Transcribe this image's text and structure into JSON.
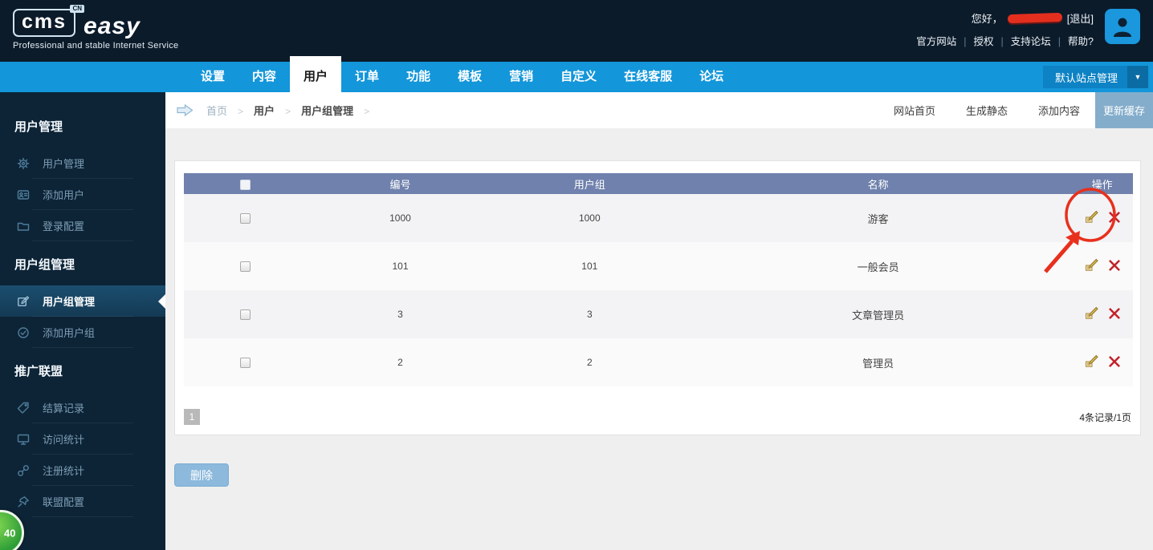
{
  "header": {
    "logo": {
      "cms": "cms",
      "cn": "CN",
      "easy": "easy",
      "tagline": "Professional and stable Internet Service"
    },
    "greeting_prefix": "您好，",
    "username_redacted": true,
    "logout_label": "[退出]",
    "links": [
      "官方网站",
      "授权",
      "支持论坛",
      "帮助?"
    ]
  },
  "nav": {
    "tabs": [
      {
        "label": "设置",
        "active": false
      },
      {
        "label": "内容",
        "active": false
      },
      {
        "label": "用户",
        "active": true
      },
      {
        "label": "订单",
        "active": false
      },
      {
        "label": "功能",
        "active": false
      },
      {
        "label": "模板",
        "active": false
      },
      {
        "label": "营销",
        "active": false
      },
      {
        "label": "自定义",
        "active": false
      },
      {
        "label": "在线客服",
        "active": false
      },
      {
        "label": "论坛",
        "active": false
      }
    ],
    "site_selector": "默认站点管理"
  },
  "sidebar": {
    "sections": [
      {
        "title": "用户管理",
        "items": [
          {
            "label": "用户管理",
            "icon": "gear-icon",
            "active": false
          },
          {
            "label": "添加用户",
            "icon": "id-card-icon",
            "active": false
          },
          {
            "label": "登录配置",
            "icon": "folder-icon",
            "active": false
          }
        ]
      },
      {
        "title": "用户组管理",
        "items": [
          {
            "label": "用户组管理",
            "icon": "edit-pad-icon",
            "active": true
          },
          {
            "label": "添加用户组",
            "icon": "check-circle-icon",
            "active": false
          }
        ]
      },
      {
        "title": "推广联盟",
        "items": [
          {
            "label": "结算记录",
            "icon": "tag-icon",
            "active": false
          },
          {
            "label": "访问统计",
            "icon": "monitor-icon",
            "active": false
          },
          {
            "label": "注册统计",
            "icon": "link-icon",
            "active": false
          },
          {
            "label": "联盟配置",
            "icon": "pin-icon",
            "active": false
          }
        ]
      }
    ],
    "badge": "40"
  },
  "breadcrumb": {
    "items": [
      "首页",
      "用户",
      "用户组管理"
    ]
  },
  "toolbar": {
    "quick_links": [
      "网站首页",
      "生成静态",
      "添加内容"
    ],
    "cache_button": "更新缓存"
  },
  "table": {
    "headers": [
      "编号",
      "用户组",
      "名称",
      "操作"
    ],
    "rows": [
      {
        "id": "1000",
        "group": "1000",
        "name": "游客"
      },
      {
        "id": "101",
        "group": "101",
        "name": "一般会员"
      },
      {
        "id": "3",
        "group": "3",
        "name": "文章管理员"
      },
      {
        "id": "2",
        "group": "2",
        "name": "管理员"
      }
    ]
  },
  "pagination": {
    "page": "1",
    "summary": "4条记录/1页"
  },
  "actions": {
    "delete_label": "删除"
  },
  "annotation": {
    "type": "circle-arrow",
    "target": "row-1-edit-icon",
    "color": "#e8301d"
  },
  "colors": {
    "header_bg": "#0c1b2a",
    "nav_blue": "#1396da",
    "sidebar_bg": "#0d2436",
    "table_header": "#6f81ac",
    "cache_button": "#84adcb",
    "delete_button": "#8cb9dc",
    "annotation_red": "#e8301d",
    "badge_green": "#2f9e38",
    "edit_icon_gold": "#e3c04f",
    "delete_icon_red": "#c2232a"
  }
}
